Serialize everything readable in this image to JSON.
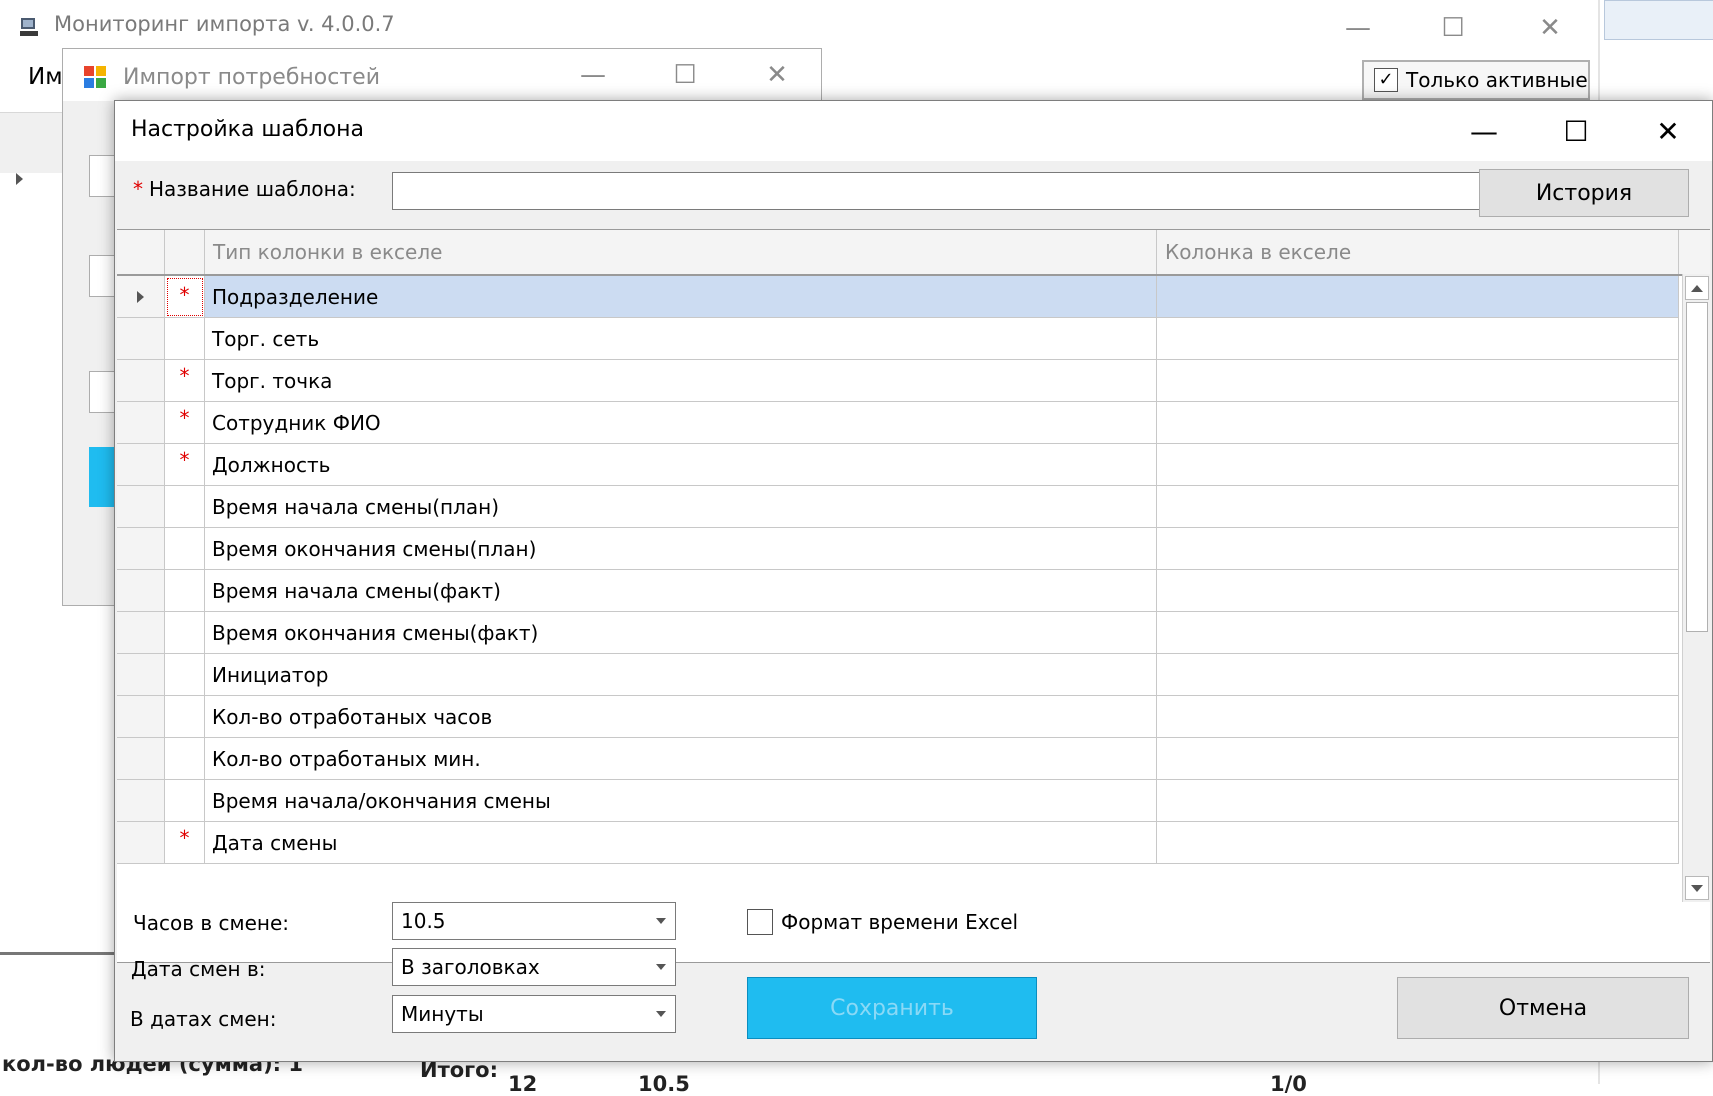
{
  "main_window": {
    "title": "Мониторинг импорта v. 4.0.0.7",
    "menu_partial": "Им",
    "only_active_label": "Только активные",
    "only_active_checked": true,
    "status_left": "кол-во людей (сумма): 1",
    "itogo_label": "Итого:",
    "itogo_values": [
      "12",
      "10.5",
      "1/0"
    ]
  },
  "import_window": {
    "title": "Импорт потребностей"
  },
  "dialog": {
    "title": "Настройка шаблона",
    "required_mark": "*",
    "template_name_label": "Название шаблона:",
    "template_name_value": "",
    "history_button": "История",
    "grid": {
      "columns": [
        "Тип колонки в екселе",
        "Колонка в екселе"
      ],
      "rows": [
        {
          "type": "Подразделение",
          "column": "",
          "required": true,
          "selected": true
        },
        {
          "type": "Торг. сеть",
          "column": "",
          "required": false,
          "selected": false
        },
        {
          "type": "Торг. точка",
          "column": "",
          "required": true,
          "selected": false
        },
        {
          "type": "Сотрудник ФИО",
          "column": "",
          "required": true,
          "selected": false
        },
        {
          "type": "Должность",
          "column": "",
          "required": true,
          "selected": false
        },
        {
          "type": "Время начала смены(план)",
          "column": "",
          "required": false,
          "selected": false
        },
        {
          "type": "Время окончания смены(план)",
          "column": "",
          "required": false,
          "selected": false
        },
        {
          "type": "Время начала смены(факт)",
          "column": "",
          "required": false,
          "selected": false
        },
        {
          "type": "Время окончания смены(факт)",
          "column": "",
          "required": false,
          "selected": false
        },
        {
          "type": "Инициатор",
          "column": "",
          "required": false,
          "selected": false
        },
        {
          "type": "Кол-во отработаных часов",
          "column": "",
          "required": false,
          "selected": false
        },
        {
          "type": "Кол-во отработаных мин.",
          "column": "",
          "required": false,
          "selected": false
        },
        {
          "type": "Время начала/окончания смены",
          "column": "",
          "required": false,
          "selected": false
        },
        {
          "type": "Дата смены",
          "column": "",
          "required": true,
          "selected": false
        }
      ]
    },
    "hours_in_shift_label": "Часов в смене:",
    "hours_in_shift_value": "10.5",
    "shift_date_in_label": "Дата смен в:",
    "shift_date_in_value": "В заголовках",
    "in_shift_dates_label": "В датах смен:",
    "in_shift_dates_value": "Минуты",
    "excel_time_format_label": "Формат времени Excel",
    "excel_time_format_checked": false,
    "save_button": "Сохранить",
    "cancel_button": "Отмена"
  },
  "colors": {
    "save_button_bg": "#1fbcf0",
    "selected_row_bg": "#ccdcf2",
    "required_mark": "#e00000"
  }
}
